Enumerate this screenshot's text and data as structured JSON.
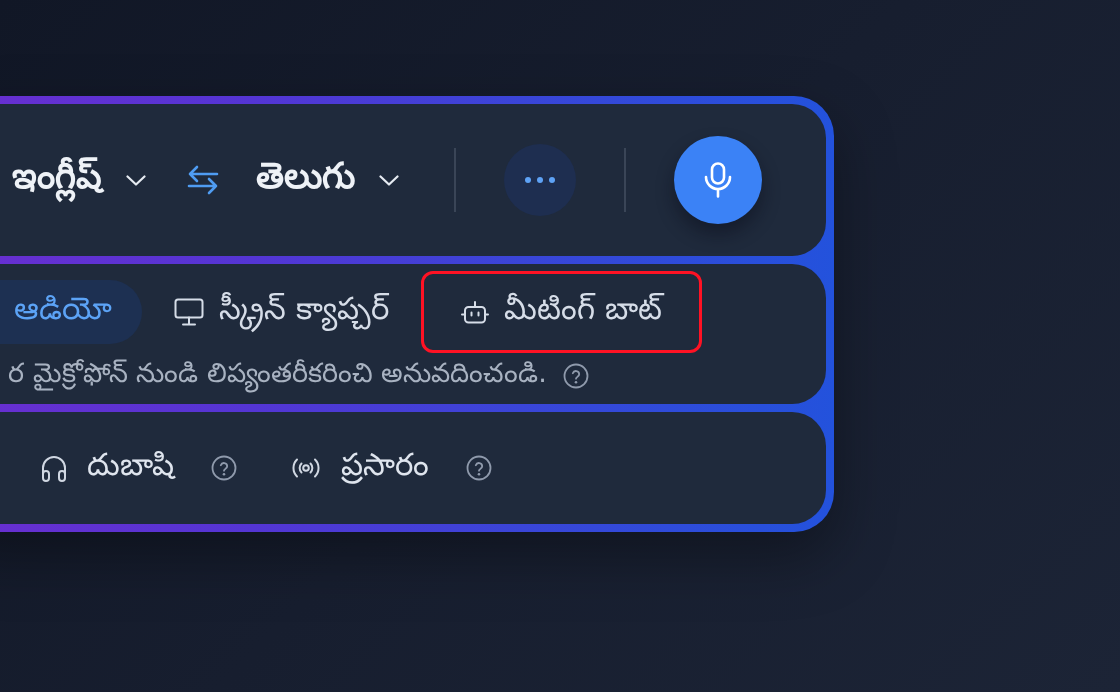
{
  "language_bar": {
    "source_language": "ఇంగ్లీష్",
    "target_language": "తెలుగు"
  },
  "capture_modes": [
    {
      "kind": "audio",
      "label": "ఆడియో",
      "selected": true,
      "highlighted": false
    },
    {
      "kind": "screen",
      "label": "స్క్రీన్ క్యాప్చర్",
      "selected": false,
      "highlighted": false
    },
    {
      "kind": "bot",
      "label": "మీటింగ్ బాట్",
      "selected": false,
      "highlighted": true
    }
  ],
  "capture_description": "ర మైక్రోఫోన్ నుండి లిప్యంతరీకరించి అనువదించండి.",
  "features": [
    {
      "kind": "interpreter",
      "label": "దుబాషి"
    },
    {
      "kind": "broadcast",
      "label": "ప్రసారం"
    }
  ]
}
